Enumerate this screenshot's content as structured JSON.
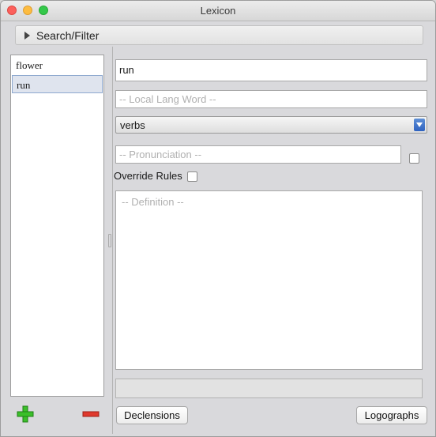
{
  "window": {
    "title": "Lexicon"
  },
  "search": {
    "label": "Search/Filter"
  },
  "word_list": [
    {
      "label": "flower",
      "selected": false
    },
    {
      "label": "run",
      "selected": true
    }
  ],
  "form": {
    "word_value": "run",
    "local_word_placeholder": "-- Local Lang Word --",
    "type_selected": "verbs",
    "pronunciation_placeholder": "-- Pronunciation --",
    "override_label": "Override Rules",
    "definition_placeholder": "-- Definition --"
  },
  "buttons": {
    "declensions": "Declensions",
    "logographs": "Logographs"
  },
  "icons": {
    "add": "plus-icon",
    "remove": "minus-icon"
  },
  "colors": {
    "add": "#3bbf2a",
    "remove": "#e0392d",
    "selection": "#dfe4ee",
    "accent": "#2e62c0"
  }
}
